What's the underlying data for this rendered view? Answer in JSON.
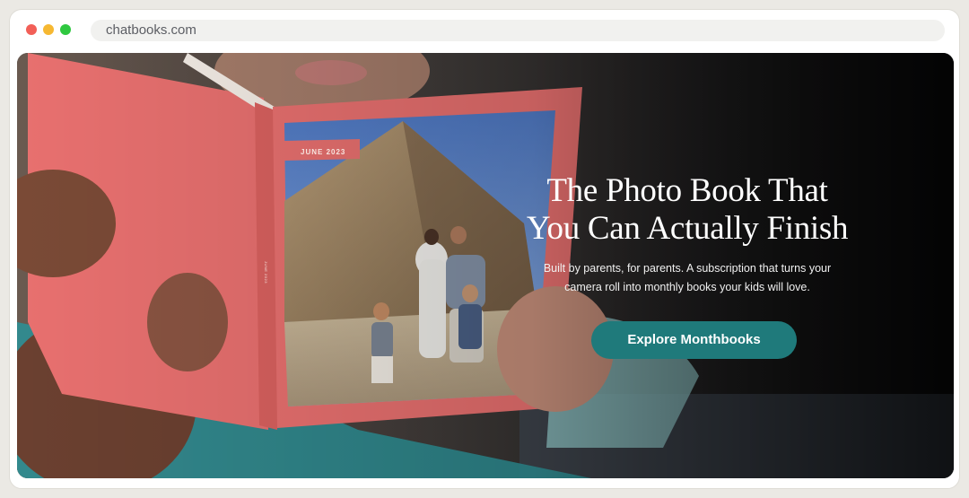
{
  "browser": {
    "url": "chatbooks.com"
  },
  "hero": {
    "title": "The Photo Book That\nYou Can Actually Finish",
    "subtitle": "Built by parents, for parents. A subscription that turns your\ncamera roll into monthly books your kids will love.",
    "cta_label": "Explore Monthbooks",
    "book_date_label": "JUNE 2023",
    "book_spine_text": "JUNE 2023"
  },
  "colors": {
    "cta": "#1f7a7b",
    "book_cover": "#e8706f",
    "background": "#1b1b1c"
  }
}
